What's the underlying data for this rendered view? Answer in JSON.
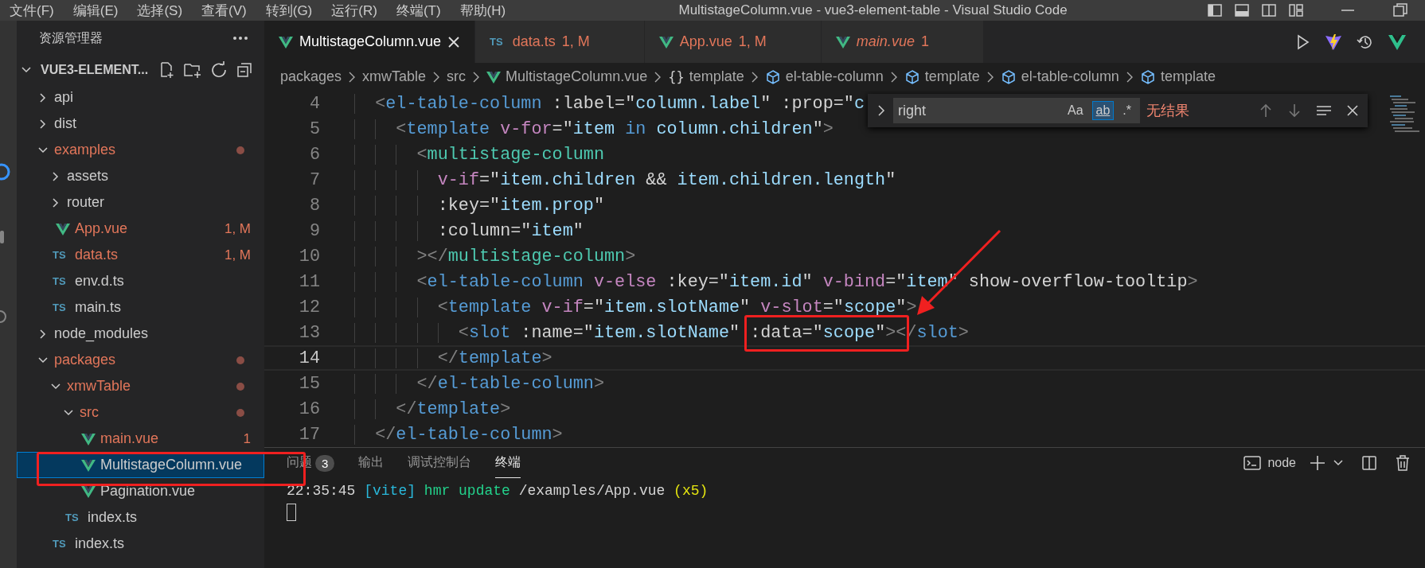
{
  "title_bar": {
    "menu": [
      "文件(F)",
      "编辑(E)",
      "选择(S)",
      "查看(V)",
      "转到(G)",
      "运行(R)",
      "终端(T)",
      "帮助(H)"
    ],
    "title": "MultistageColumn.vue - vue3-element-table - Visual Studio Code"
  },
  "sidebar": {
    "title": "资源管理器",
    "project": {
      "name": "VUE3-ELEMENT...",
      "expanded": true
    },
    "tree": [
      {
        "label": "api",
        "kind": "folder",
        "expanded": false,
        "modified": false,
        "selected": false
      },
      {
        "label": "dist",
        "kind": "folder",
        "expanded": false,
        "modified": false,
        "selected": false
      },
      {
        "label": "examples",
        "kind": "folder",
        "expanded": true,
        "modified": true,
        "selected": false,
        "children": [
          {
            "label": "assets",
            "kind": "folder",
            "expanded": false,
            "modified": false,
            "selected": false
          },
          {
            "label": "router",
            "kind": "folder",
            "expanded": false,
            "modified": false,
            "selected": false
          },
          {
            "label": "App.vue",
            "kind": "vue",
            "modified": true,
            "badge": "1, M",
            "selected": false
          },
          {
            "label": "data.ts",
            "kind": "ts",
            "icon_label": "TS",
            "modified": true,
            "badge": "1, M",
            "selected": false
          },
          {
            "label": "env.d.ts",
            "kind": "ts",
            "icon_label": "TS",
            "modified": false,
            "selected": false
          },
          {
            "label": "main.ts",
            "kind": "ts",
            "icon_label": "TS",
            "modified": false,
            "selected": false
          }
        ]
      },
      {
        "label": "node_modules",
        "kind": "folder",
        "expanded": false,
        "modified": false,
        "selected": false
      },
      {
        "label": "packages",
        "kind": "folder",
        "expanded": true,
        "modified": true,
        "selected": false,
        "children": [
          {
            "label": "xmwTable",
            "kind": "folder",
            "expanded": true,
            "modified": true,
            "selected": false,
            "children": [
              {
                "label": "src",
                "kind": "folder",
                "expanded": true,
                "modified": true,
                "selected": false,
                "children": [
                  {
                    "label": "main.vue",
                    "kind": "vue",
                    "modified": true,
                    "badge": "1",
                    "selected": false
                  },
                  {
                    "label": "MultistageColumn.vue",
                    "kind": "vue",
                    "modified": false,
                    "selected": true
                  },
                  {
                    "label": "Pagination.vue",
                    "kind": "vue",
                    "modified": false,
                    "selected": false
                  }
                ]
              },
              {
                "label": "index.ts",
                "kind": "ts",
                "icon_label": "TS",
                "modified": false,
                "selected": false
              }
            ]
          },
          {
            "label": "index.ts",
            "kind": "ts",
            "icon_label": "TS",
            "modified": false,
            "selected": false
          }
        ]
      }
    ]
  },
  "tabs": [
    {
      "label": "MultistageColumn.vue",
      "kind": "vue",
      "selected": true,
      "modified": false,
      "preview": false
    },
    {
      "label": "data.ts",
      "kind": "ts",
      "icon_label": "TS",
      "badge": "1, M",
      "selected": false,
      "modified": true,
      "preview": false
    },
    {
      "label": "App.vue",
      "kind": "vue",
      "badge": "1, M",
      "selected": false,
      "modified": true,
      "preview": false
    },
    {
      "label": "main.vue",
      "kind": "vue",
      "badge": "1",
      "selected": false,
      "modified": true,
      "preview": true
    }
  ],
  "breadcrumbs": [
    {
      "label": "packages",
      "kind": "plain"
    },
    {
      "label": "xmwTable",
      "kind": "plain"
    },
    {
      "label": "src",
      "kind": "plain"
    },
    {
      "label": "MultistageColumn.vue",
      "kind": "vue"
    },
    {
      "label": "template",
      "kind": "braces",
      "icon_label": "{}"
    },
    {
      "label": "el-table-column",
      "kind": "cube"
    },
    {
      "label": "template",
      "kind": "cube"
    },
    {
      "label": "el-table-column",
      "kind": "cube"
    },
    {
      "label": "template",
      "kind": "cube"
    }
  ],
  "find": {
    "value": "right",
    "options": [
      {
        "label": "Aa",
        "selected": false
      },
      {
        "label": "ab",
        "selected": true
      },
      {
        "label": ".*",
        "selected": false
      }
    ],
    "result": "无结果"
  },
  "code": {
    "lines": [
      {
        "number": "4",
        "current": false,
        "tokens": [
          {
            "kind": "bracket",
            "text": "  <"
          },
          {
            "kind": "tag",
            "text": "el-table-column"
          },
          {
            "kind": "plain",
            "text": " :label=\""
          },
          {
            "kind": "string",
            "text": "column.label"
          },
          {
            "kind": "plain",
            "text": "\" :prop=\""
          },
          {
            "kind": "string",
            "text": "c"
          }
        ]
      },
      {
        "number": "5",
        "current": false,
        "tokens": [
          {
            "kind": "bracket",
            "text": "    <"
          },
          {
            "kind": "tag",
            "text": "template"
          },
          {
            "kind": "directive",
            "text": " v-for"
          },
          {
            "kind": "plain",
            "text": "=\""
          },
          {
            "kind": "string",
            "text": "item "
          },
          {
            "kind": "keyword",
            "text": "in"
          },
          {
            "kind": "string",
            "text": " column.children"
          },
          {
            "kind": "plain",
            "text": "\""
          },
          {
            "kind": "bracket",
            "text": ">"
          }
        ]
      },
      {
        "number": "6",
        "current": false,
        "tokens": [
          {
            "kind": "bracket",
            "text": "      <"
          },
          {
            "kind": "component",
            "text": "multistage-column"
          }
        ]
      },
      {
        "number": "7",
        "current": false,
        "tokens": [
          {
            "kind": "directive",
            "text": "        v-if"
          },
          {
            "kind": "plain",
            "text": "=\""
          },
          {
            "kind": "string",
            "text": "item.children"
          },
          {
            "kind": "plain",
            "text": " && "
          },
          {
            "kind": "string",
            "text": "item.children.length"
          },
          {
            "kind": "plain",
            "text": "\""
          }
        ]
      },
      {
        "number": "8",
        "current": false,
        "tokens": [
          {
            "kind": "plain",
            "text": "        :key=\""
          },
          {
            "kind": "string",
            "text": "item.prop"
          },
          {
            "kind": "plain",
            "text": "\""
          }
        ]
      },
      {
        "number": "9",
        "current": false,
        "tokens": [
          {
            "kind": "plain",
            "text": "        :column=\""
          },
          {
            "kind": "string",
            "text": "item"
          },
          {
            "kind": "plain",
            "text": "\""
          }
        ]
      },
      {
        "number": "10",
        "current": false,
        "tokens": [
          {
            "kind": "bracket",
            "text": "      ></"
          },
          {
            "kind": "component",
            "text": "multistage-column"
          },
          {
            "kind": "bracket",
            "text": ">"
          }
        ]
      },
      {
        "number": "11",
        "current": false,
        "tokens": [
          {
            "kind": "bracket",
            "text": "      <"
          },
          {
            "kind": "tag",
            "text": "el-table-column"
          },
          {
            "kind": "directive",
            "text": " v-else"
          },
          {
            "kind": "plain",
            "text": " :key=\""
          },
          {
            "kind": "string",
            "text": "item.id"
          },
          {
            "kind": "plain",
            "text": "\""
          },
          {
            "kind": "directive",
            "text": " v-bind"
          },
          {
            "kind": "plain",
            "text": "=\""
          },
          {
            "kind": "string",
            "text": "item"
          },
          {
            "kind": "plain",
            "text": "\" show-overflow-tooltip"
          },
          {
            "kind": "bracket",
            "text": ">"
          }
        ]
      },
      {
        "number": "12",
        "current": false,
        "tokens": [
          {
            "kind": "bracket",
            "text": "        <"
          },
          {
            "kind": "tag",
            "text": "template"
          },
          {
            "kind": "directive",
            "text": " v-if"
          },
          {
            "kind": "plain",
            "text": "=\""
          },
          {
            "kind": "string",
            "text": "item.slotName"
          },
          {
            "kind": "plain",
            "text": "\""
          },
          {
            "kind": "directive",
            "text": " v-slot"
          },
          {
            "kind": "plain",
            "text": "=\""
          },
          {
            "kind": "string",
            "text": "scope"
          },
          {
            "kind": "plain",
            "text": "\""
          },
          {
            "kind": "bracket",
            "text": ">"
          }
        ]
      },
      {
        "number": "13",
        "current": false,
        "tokens": [
          {
            "kind": "bracket",
            "text": "          <"
          },
          {
            "kind": "tag",
            "text": "slot"
          },
          {
            "kind": "plain",
            "text": " :name=\""
          },
          {
            "kind": "string",
            "text": "item.slotName"
          },
          {
            "kind": "plain",
            "text": "\" :data=\""
          },
          {
            "kind": "string",
            "text": "scope"
          },
          {
            "kind": "plain",
            "text": "\""
          },
          {
            "kind": "bracket",
            "text": "></"
          },
          {
            "kind": "tag",
            "text": "slot"
          },
          {
            "kind": "bracket",
            "text": ">"
          }
        ]
      },
      {
        "number": "14",
        "current": true,
        "tokens": [
          {
            "kind": "bracket",
            "text": "        </"
          },
          {
            "kind": "tag",
            "text": "template"
          },
          {
            "kind": "bracket",
            "text": ">"
          }
        ]
      },
      {
        "number": "15",
        "current": false,
        "tokens": [
          {
            "kind": "bracket",
            "text": "      </"
          },
          {
            "kind": "tag",
            "text": "el-table-column"
          },
          {
            "kind": "bracket",
            "text": ">"
          }
        ]
      },
      {
        "number": "16",
        "current": false,
        "tokens": [
          {
            "kind": "bracket",
            "text": "    </"
          },
          {
            "kind": "tag",
            "text": "template"
          },
          {
            "kind": "bracket",
            "text": ">"
          }
        ]
      },
      {
        "number": "17",
        "current": false,
        "tokens": [
          {
            "kind": "bracket",
            "text": "  </"
          },
          {
            "kind": "tag",
            "text": "el-table-column"
          },
          {
            "kind": "bracket",
            "text": ">"
          }
        ]
      }
    ]
  },
  "panel": {
    "tabs": [
      {
        "label": "问题",
        "badge": "3",
        "selected": false
      },
      {
        "label": "输出",
        "selected": false
      },
      {
        "label": "调试控制台",
        "selected": false
      },
      {
        "label": "终端",
        "selected": true
      }
    ],
    "terminal_name": "node",
    "terminal": [
      [
        {
          "kind": "plain",
          "text": "22:35:45 "
        },
        {
          "kind": "info",
          "text": "[vite]"
        },
        {
          "kind": "success",
          "text": " hmr update"
        },
        {
          "kind": "plain",
          "text": " /examples/App.vue "
        },
        {
          "kind": "count",
          "text": "(x5)"
        }
      ]
    ]
  }
}
